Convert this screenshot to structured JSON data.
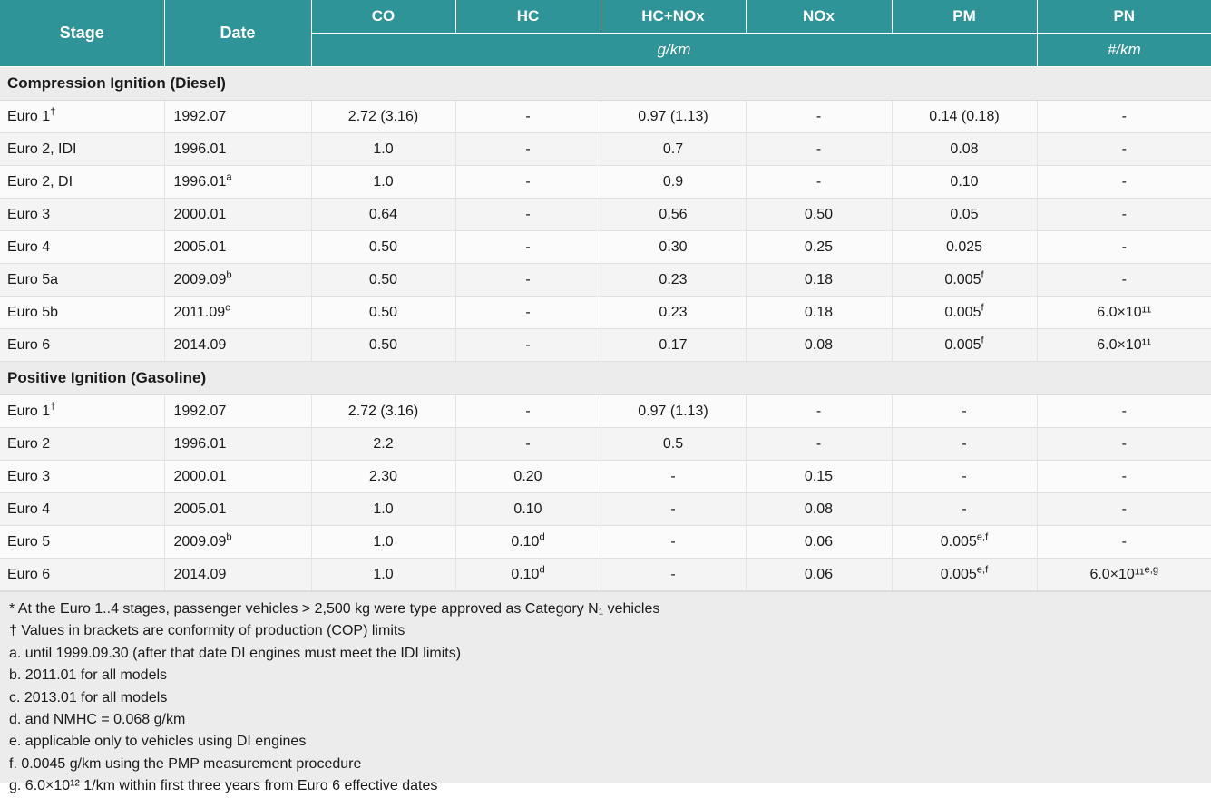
{
  "header": {
    "stage": "Stage",
    "date": "Date",
    "pollutants": [
      "CO",
      "HC",
      "HC+NOx",
      "NOx",
      "PM",
      "PN"
    ],
    "units": [
      {
        "label": "g/km",
        "span": 5
      },
      {
        "label": "#/km",
        "span": 1
      }
    ]
  },
  "sections": [
    {
      "title": "Compression Ignition (Diesel)",
      "rows": [
        {
          "stage": "Euro 1",
          "stage_sup": "†",
          "date": "1992.07",
          "date_sup": "",
          "co": "2.72 (3.16)",
          "hc": "-",
          "hcnox": "0.97 (1.13)",
          "nox": "-",
          "pm": "0.14 (0.18)",
          "pm_sup": "",
          "pn": "-",
          "pn_sup": ""
        },
        {
          "stage": "Euro 2, IDI",
          "stage_sup": "",
          "date": "1996.01",
          "date_sup": "",
          "co": "1.0",
          "hc": "-",
          "hcnox": "0.7",
          "nox": "-",
          "pm": "0.08",
          "pm_sup": "",
          "pn": "-",
          "pn_sup": ""
        },
        {
          "stage": "Euro 2, DI",
          "stage_sup": "",
          "date": "1996.01",
          "date_sup": "a",
          "co": "1.0",
          "hc": "-",
          "hcnox": "0.9",
          "nox": "-",
          "pm": "0.10",
          "pm_sup": "",
          "pn": "-",
          "pn_sup": ""
        },
        {
          "stage": "Euro 3",
          "stage_sup": "",
          "date": "2000.01",
          "date_sup": "",
          "co": "0.64",
          "hc": "-",
          "hcnox": "0.56",
          "nox": "0.50",
          "pm": "0.05",
          "pm_sup": "",
          "pn": "-",
          "pn_sup": ""
        },
        {
          "stage": "Euro 4",
          "stage_sup": "",
          "date": "2005.01",
          "date_sup": "",
          "co": "0.50",
          "hc": "-",
          "hcnox": "0.30",
          "nox": "0.25",
          "pm": "0.025",
          "pm_sup": "",
          "pn": "-",
          "pn_sup": ""
        },
        {
          "stage": "Euro 5a",
          "stage_sup": "",
          "date": "2009.09",
          "date_sup": "b",
          "co": "0.50",
          "hc": "-",
          "hcnox": "0.23",
          "nox": "0.18",
          "pm": "0.005",
          "pm_sup": "f",
          "pn": "-",
          "pn_sup": ""
        },
        {
          "stage": "Euro 5b",
          "stage_sup": "",
          "date": "2011.09",
          "date_sup": "c",
          "co": "0.50",
          "hc": "-",
          "hcnox": "0.23",
          "nox": "0.18",
          "pm": "0.005",
          "pm_sup": "f",
          "pn": "6.0×10¹¹",
          "pn_sup": ""
        },
        {
          "stage": "Euro 6",
          "stage_sup": "",
          "date": "2014.09",
          "date_sup": "",
          "co": "0.50",
          "hc": "-",
          "hcnox": "0.17",
          "nox": "0.08",
          "pm": "0.005",
          "pm_sup": "f",
          "pn": "6.0×10¹¹",
          "pn_sup": ""
        }
      ]
    },
    {
      "title": "Positive Ignition (Gasoline)",
      "rows": [
        {
          "stage": "Euro 1",
          "stage_sup": "†",
          "date": "1992.07",
          "date_sup": "",
          "co": "2.72 (3.16)",
          "hc": "-",
          "hc_sup": "",
          "hcnox": "0.97 (1.13)",
          "nox": "-",
          "pm": "-",
          "pm_sup": "",
          "pn": "-",
          "pn_sup": ""
        },
        {
          "stage": "Euro 2",
          "stage_sup": "",
          "date": "1996.01",
          "date_sup": "",
          "co": "2.2",
          "hc": "-",
          "hc_sup": "",
          "hcnox": "0.5",
          "nox": "-",
          "pm": "-",
          "pm_sup": "",
          "pn": "-",
          "pn_sup": ""
        },
        {
          "stage": "Euro 3",
          "stage_sup": "",
          "date": "2000.01",
          "date_sup": "",
          "co": "2.30",
          "hc": "0.20",
          "hc_sup": "",
          "hcnox": "-",
          "nox": "0.15",
          "pm": "-",
          "pm_sup": "",
          "pn": "-",
          "pn_sup": ""
        },
        {
          "stage": "Euro 4",
          "stage_sup": "",
          "date": "2005.01",
          "date_sup": "",
          "co": "1.0",
          "hc": "0.10",
          "hc_sup": "",
          "hcnox": "-",
          "nox": "0.08",
          "pm": "-",
          "pm_sup": "",
          "pn": "-",
          "pn_sup": ""
        },
        {
          "stage": "Euro 5",
          "stage_sup": "",
          "date": "2009.09",
          "date_sup": "b",
          "co": "1.0",
          "hc": "0.10",
          "hc_sup": "d",
          "hcnox": "-",
          "nox": "0.06",
          "pm": "0.005",
          "pm_sup": "e,f",
          "pn": "-",
          "pn_sup": ""
        },
        {
          "stage": "Euro 6",
          "stage_sup": "",
          "date": "2014.09",
          "date_sup": "",
          "co": "1.0",
          "hc": "0.10",
          "hc_sup": "d",
          "hcnox": "-",
          "nox": "0.06",
          "pm": "0.005",
          "pm_sup": "e,f",
          "pn": "6.0×10¹¹",
          "pn_sup": "e,g"
        }
      ]
    }
  ],
  "footnotes": [
    "* At the Euro 1..4 stages, passenger vehicles > 2,500 kg were type approved as Category N₁ vehicles",
    "† Values in brackets are conformity of production (COP) limits",
    "a. until 1999.09.30 (after that date DI engines must meet the IDI limits)",
    "b. 2011.01 for all models",
    "c. 2013.01 for all models",
    "d. and NMHC = 0.068 g/km",
    "e. applicable only to vehicles using DI engines",
    "f. 0.0045 g/km using the PMP measurement procedure",
    "g. 6.0×10¹² 1/km within first three years from Euro 6 effective dates"
  ],
  "colors": {
    "header_teal": "#2e9498",
    "section_bg": "#ececec",
    "row_odd": "#fbfbfb",
    "row_even": "#f4f4f4"
  }
}
